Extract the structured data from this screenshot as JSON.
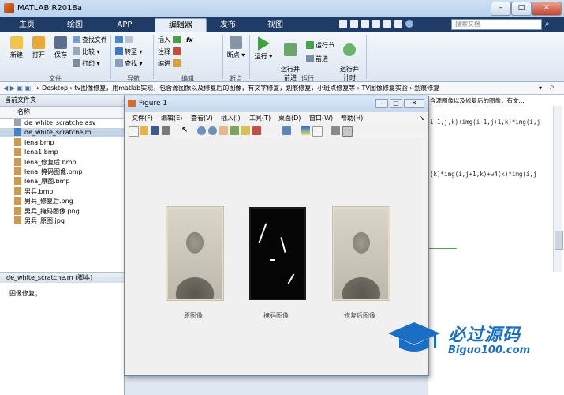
{
  "window": {
    "title": "MATLAB R2018a",
    "search_placeholder": "搜索文档",
    "min": "–",
    "max": "□",
    "close": "✕"
  },
  "tabs": [
    "主页",
    "绘图",
    "APP",
    "编辑器",
    "发布",
    "视图"
  ],
  "ribbon": {
    "new": "新建",
    "open": "打开",
    "save": "保存",
    "find_files": "查找文件",
    "compare": "比较",
    "print": "打印",
    "goto": "转至",
    "find": "查找",
    "insert": "插入",
    "comment": "注释",
    "indent": "缩进",
    "fx": "fx",
    "breakpoints": "断点",
    "run": "运行",
    "run_advance": "运行并\n前进",
    "run_section": "运行节",
    "advance": "前进",
    "run_time": "运行并\n计时",
    "groups": [
      "文件",
      "导航",
      "编辑",
      "断点",
      "运行"
    ]
  },
  "address": {
    "path": "« Desktop › tv图像修复，用matlab实现，包含源图像以及修复后的图像，有文字修复，划痕修复，小斑点修复等 › TV图像修复实验 › 划痕修复"
  },
  "left_panel": {
    "header": "当前文件夹",
    "col_name": "名称",
    "files": [
      {
        "name": "de_white_scratche.asv",
        "type": "asv",
        "selected": false
      },
      {
        "name": "de_white_scratche.m",
        "type": "m",
        "selected": true
      },
      {
        "name": "lena.bmp",
        "type": "img",
        "selected": false
      },
      {
        "name": "lena1.bmp",
        "type": "img",
        "selected": false
      },
      {
        "name": "lena_修复后.bmp",
        "type": "img",
        "selected": false
      },
      {
        "name": "lena_掩码图像.bmp",
        "type": "img",
        "selected": false
      },
      {
        "name": "lena_原图.bmp",
        "type": "img",
        "selected": false
      },
      {
        "name": "男兵.bmp",
        "type": "img",
        "selected": false
      },
      {
        "name": "男兵_修复后.png",
        "type": "img",
        "selected": false
      },
      {
        "name": "男兵_掩码图像.png",
        "type": "img",
        "selected": false
      },
      {
        "name": "男兵_原图.jpg",
        "type": "img",
        "selected": false
      }
    ],
    "details_file": "de_white_scratche.m",
    "details_kind": "(脚本)",
    "details_text": "图像修复；"
  },
  "editor": {
    "line1": "i-1,j,k)+img(i-1,j+1,k)*img(i,j",
    "line2": "(k)*img(i,j+1,k)+w4(k)*img(i,j",
    "tab_title": "含源图像以及修复后的图像，有文..."
  },
  "figure": {
    "title": "Figure 1",
    "menu": [
      "文件(F)",
      "编辑(E)",
      "查看(V)",
      "插入(I)",
      "工具(T)",
      "桌面(D)",
      "窗口(W)",
      "帮助(H)"
    ],
    "captions": [
      "原图像",
      "掩码图像",
      "修复后图像"
    ]
  },
  "watermark": {
    "cn": "必过源码",
    "en": "Biguo100.com"
  },
  "colors": {
    "tabbar": "#1f3c66",
    "accent": "#1a6ec4",
    "selected_row": "#c5d3e6"
  }
}
